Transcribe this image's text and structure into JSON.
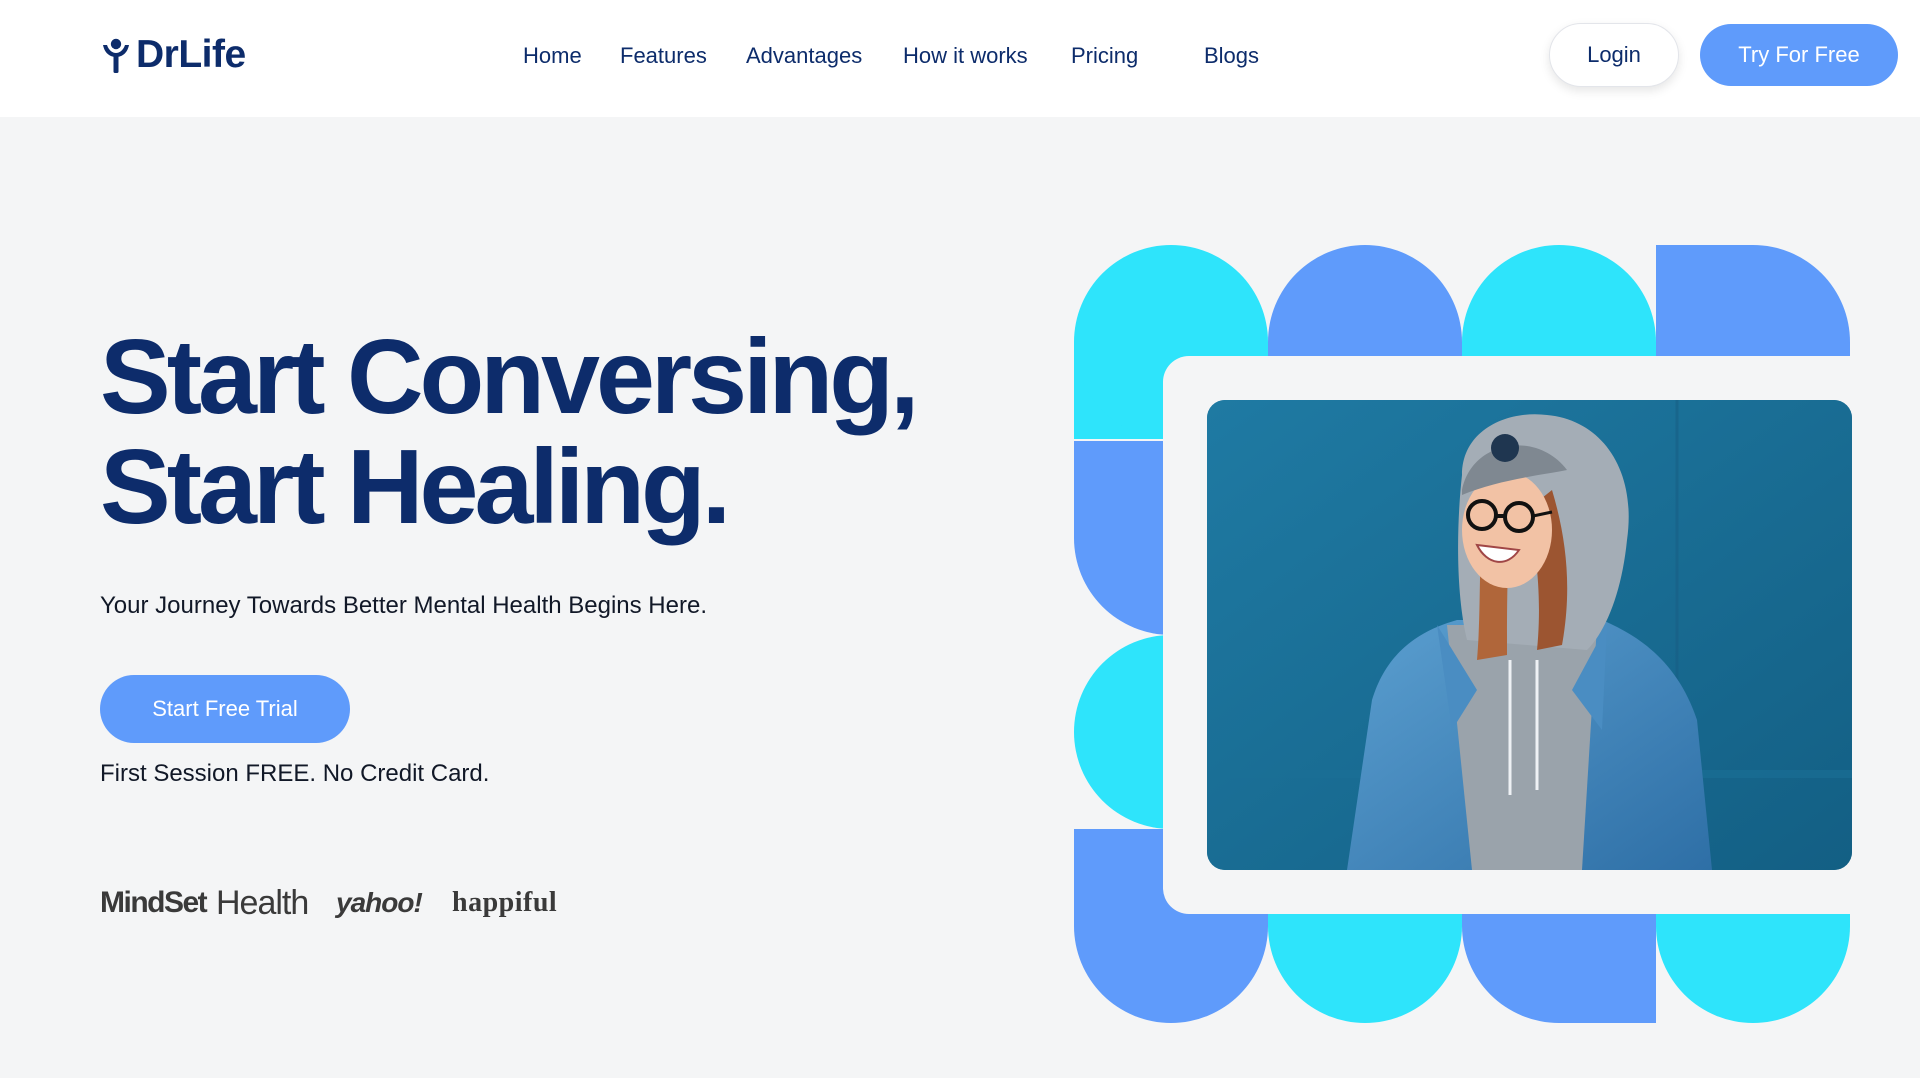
{
  "brand": {
    "name": "DrLife",
    "logo_icon": "person-figure-icon",
    "color": "#0d2c6b"
  },
  "nav": {
    "items": [
      {
        "label": "Home"
      },
      {
        "label": "Features"
      },
      {
        "label": "Advantages"
      },
      {
        "label": "How it works"
      },
      {
        "label": "Pricing"
      },
      {
        "label": "Blogs"
      }
    ],
    "login_label": "Login",
    "cta_label": "Try For Free"
  },
  "hero": {
    "title_line1": "Start Conversing,",
    "title_line2": "Start Healing.",
    "subtitle": "Your Journey Towards Better Mental Health Begins Here.",
    "cta_label": "Start Free Trial",
    "note": "First Session FREE. No Credit Card.",
    "press_logos": [
      "MindSet",
      "Health",
      "yahoo!",
      "happiful"
    ],
    "image": "smiling-woman-in-hoodie-and-denim-jacket-photo"
  },
  "colors": {
    "accent_blue": "#5f9bfb",
    "accent_cyan": "#2ee4fb",
    "background": "#f4f5f6",
    "text_dark": "#0d2c6b"
  }
}
